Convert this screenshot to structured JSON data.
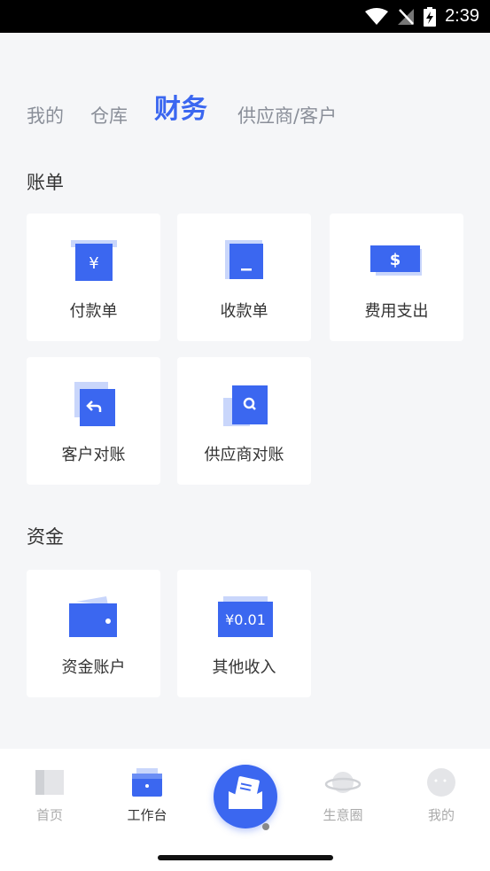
{
  "status_bar": {
    "time": "2:39"
  },
  "tabs": [
    {
      "label": "我的",
      "active": false
    },
    {
      "label": "仓库",
      "active": false
    },
    {
      "label": "财务",
      "active": true
    },
    {
      "label": "供应商/客户",
      "active": false
    }
  ],
  "sections": {
    "bills": {
      "title": "账单",
      "items": [
        {
          "label": "付款单",
          "icon": "yen-bill-icon"
        },
        {
          "label": "收款单",
          "icon": "receipt-icon"
        },
        {
          "label": "费用支出",
          "icon": "dollar-bill-icon"
        },
        {
          "label": "客户对账",
          "icon": "reply-doc-icon"
        },
        {
          "label": "供应商对账",
          "icon": "search-doc-icon"
        }
      ]
    },
    "funds": {
      "title": "资金",
      "items": [
        {
          "label": "资金账户",
          "icon": "wallet-icon"
        },
        {
          "label": "其他收入",
          "icon": "amount-card-icon",
          "amount": "¥0.01"
        }
      ]
    }
  },
  "bottom_nav": [
    {
      "label": "首页",
      "icon": "home-icon",
      "active": false
    },
    {
      "label": "工作台",
      "icon": "workbench-icon",
      "active": true
    },
    {
      "label": "",
      "icon": "compose-icon",
      "active": false
    },
    {
      "label": "生意圈",
      "icon": "planet-icon",
      "active": false
    },
    {
      "label": "我的",
      "icon": "profile-icon",
      "active": false
    }
  ],
  "colors": {
    "accent": "#3b67f0",
    "accent_light": "#c9d6fb",
    "background": "#f5f6f8"
  }
}
